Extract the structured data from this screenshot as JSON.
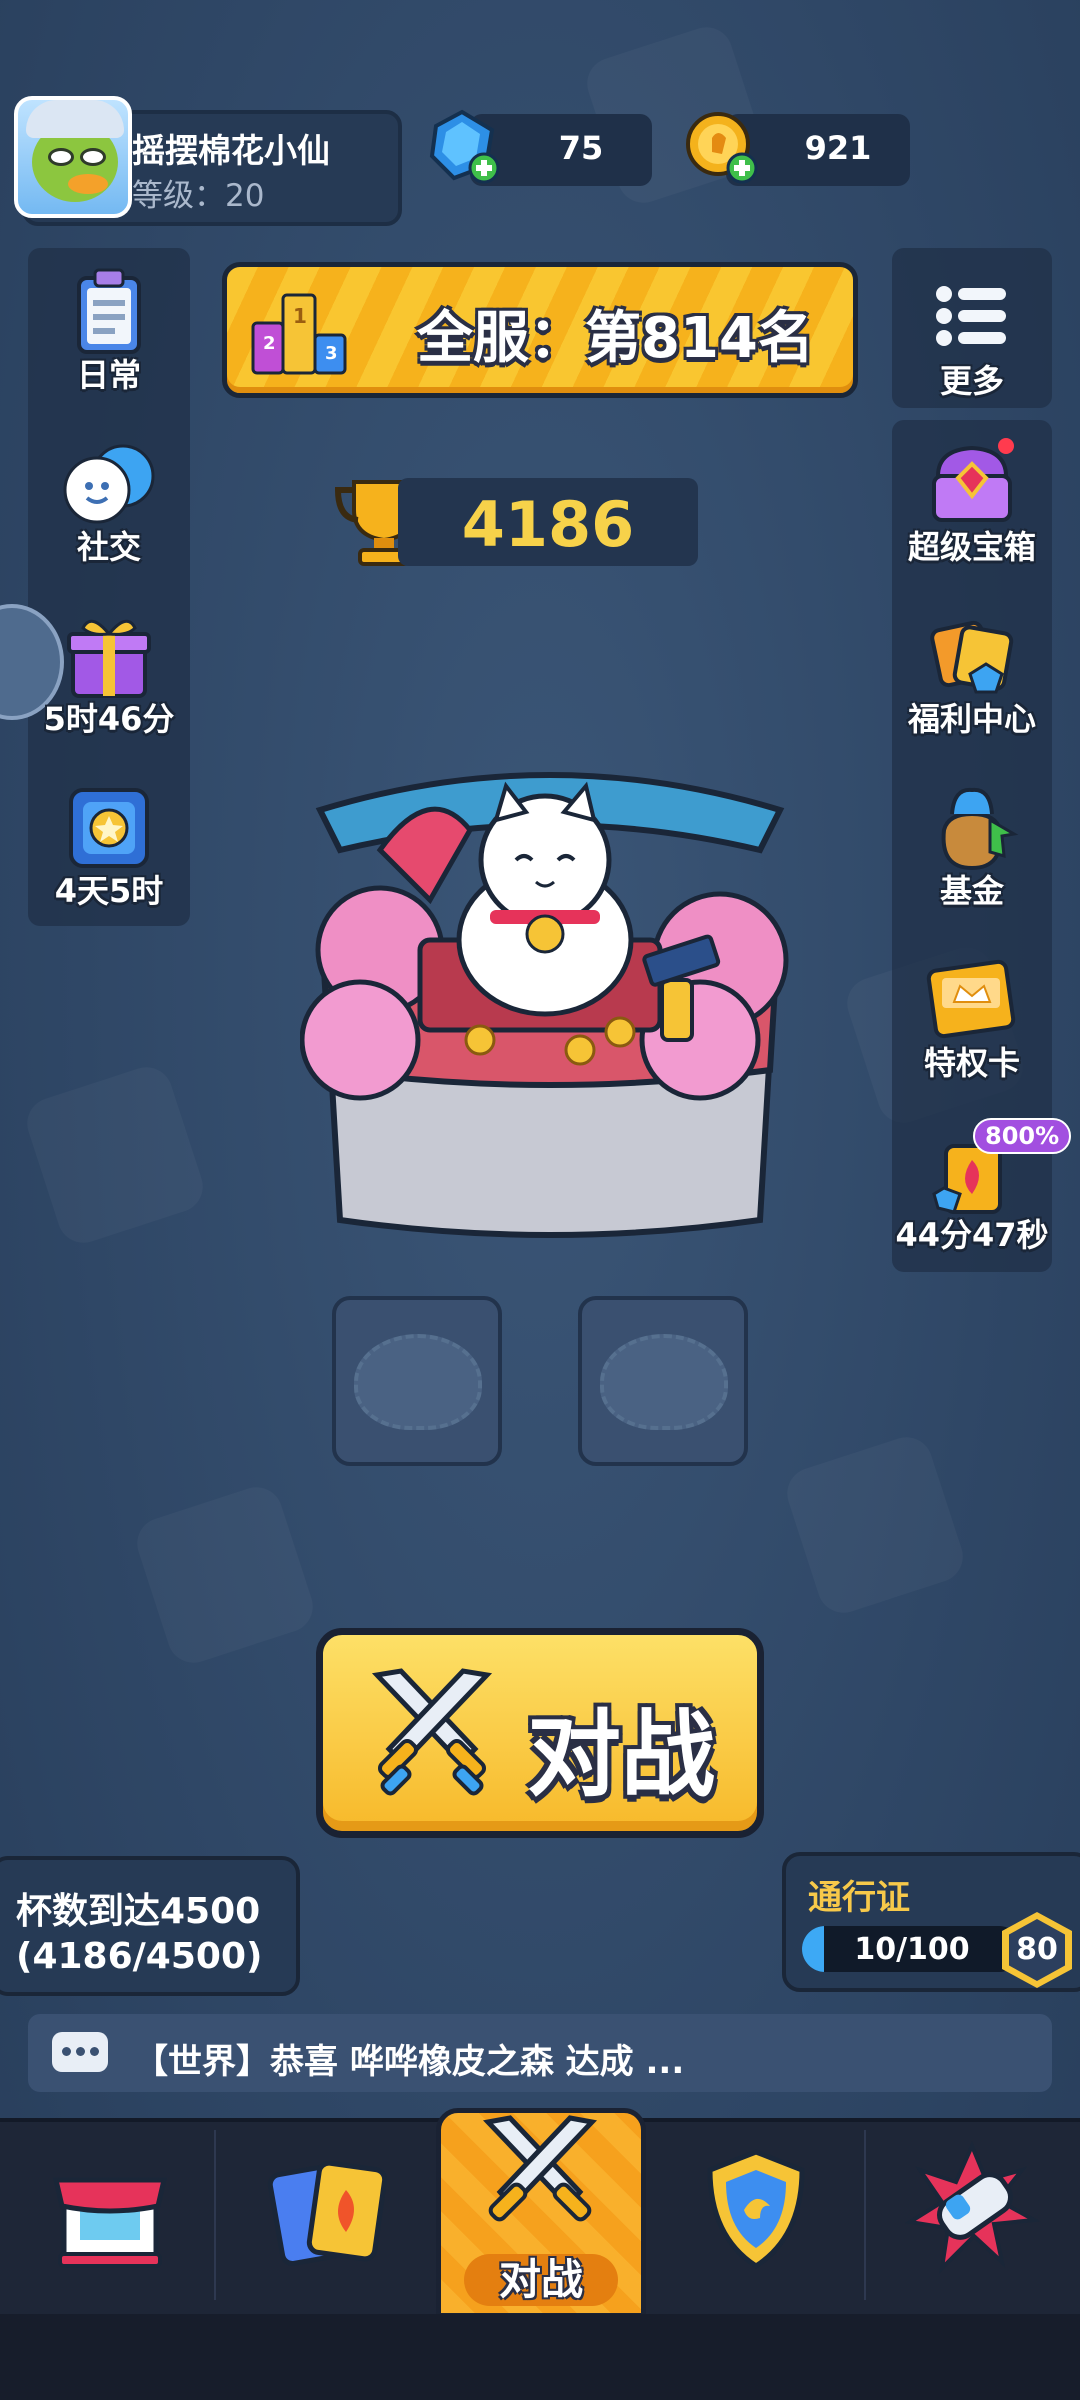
{
  "player": {
    "name": "摇摆棉花小仙",
    "level_label": "等级：20"
  },
  "currencies": {
    "gems": "75",
    "coins": "921"
  },
  "rank_banner": "全服：第814名",
  "trophies": "4186",
  "left_menu": [
    {
      "label": "日常",
      "icon": "clipboard-icon"
    },
    {
      "label": "社交",
      "icon": "chat-bubbles-icon"
    },
    {
      "label": "5时46分",
      "icon": "gift-box-icon"
    },
    {
      "label": "4天5时",
      "icon": "star-card-icon"
    }
  ],
  "right_menu": {
    "more": "更多",
    "items": [
      {
        "label": "超级宝箱",
        "icon": "super-chest-icon"
      },
      {
        "label": "福利中心",
        "icon": "welfare-icon"
      },
      {
        "label": "基金",
        "icon": "fund-bag-icon"
      },
      {
        "label": "特权卡",
        "icon": "privilege-card-icon"
      },
      {
        "label": "44分47秒",
        "icon": "boost-offer-icon",
        "badge": "800%"
      }
    ]
  },
  "battle_button": "对战",
  "cup_goal": {
    "line1": "杯数到达4500",
    "line2": "(4186/4500)"
  },
  "pass": {
    "title": "通行证",
    "progress_text": "10/100",
    "progress_fraction": 0.1,
    "level": "80"
  },
  "chat_message": "【世界】恭喜 哗哗橡皮之森 达成 ...",
  "bottom_nav": {
    "active_label": "对战",
    "items": [
      "shop-icon",
      "cards-icon",
      "battle-swords-icon",
      "clan-shield-icon",
      "rocket-fist-icon"
    ]
  },
  "colors": {
    "background": "#2f4766",
    "accent_yellow": "#f9c630",
    "trophy_text": "#f7d24a",
    "pass_title": "#f7c94a"
  }
}
